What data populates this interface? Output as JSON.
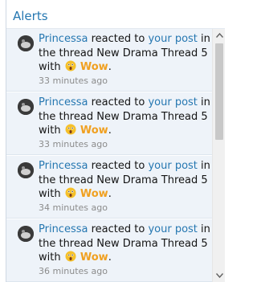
{
  "header": {
    "title": "Alerts"
  },
  "alerts": [
    {
      "user": "Princessa",
      "action": "reacted to",
      "target": "your post",
      "mid": "in the thread",
      "thread": "New Drama Thread 5",
      "with": "with",
      "reaction": "Wow",
      "end": ".",
      "time": "33 minutes ago"
    },
    {
      "user": "Princessa",
      "action": "reacted to",
      "target": "your post",
      "mid": "in the thread",
      "thread": "New Drama Thread 5",
      "with": "with",
      "reaction": "Wow",
      "end": ".",
      "time": "33 minutes ago"
    },
    {
      "user": "Princessa",
      "action": "reacted to",
      "target": "your post",
      "mid": "in the thread",
      "thread": "New Drama Thread 5",
      "with": "with",
      "reaction": "Wow",
      "end": ".",
      "time": "34 minutes ago"
    },
    {
      "user": "Princessa",
      "action": "reacted to",
      "target": "your post",
      "mid": "in the thread",
      "thread": "New Drama Thread 5",
      "with": "with",
      "reaction": "Wow",
      "end": ".",
      "time": "36 minutes ago"
    }
  ],
  "colors": {
    "link": "#2577b1",
    "reaction": "#f0a020",
    "alert_bg": "#eef3f9"
  },
  "icons": {
    "avatar": "avatar-image",
    "reaction": "wow-emoji-icon",
    "scroll_up": "chevron-up-icon",
    "scroll_down": "chevron-down-icon"
  }
}
